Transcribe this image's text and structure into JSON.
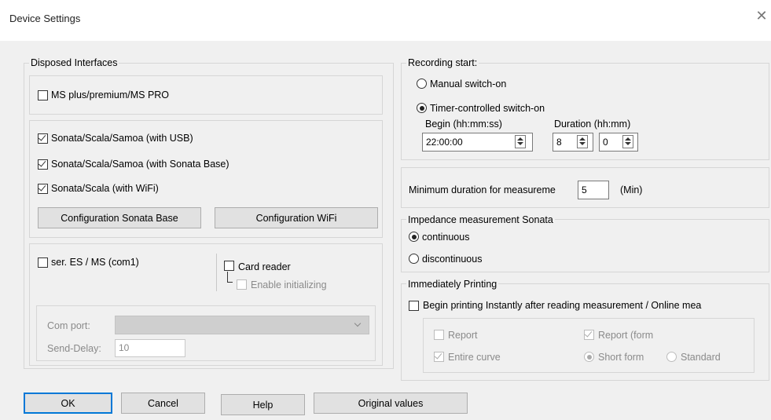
{
  "window": {
    "title": "Device Settings",
    "close_glyph": "✕"
  },
  "disposed": {
    "label": "Disposed Interfaces",
    "ms_plus": {
      "label": "MS plus/premium/MS PRO",
      "checked": false
    },
    "sonata_usb": {
      "label": "Sonata/Scala/Samoa (with USB)",
      "checked": true
    },
    "sonata_base": {
      "label": "Sonata/Scala/Samoa (with Sonata Base)",
      "checked": true
    },
    "sonata_wifi": {
      "label": "Sonata/Scala (with WiFi)",
      "checked": true
    },
    "config_base_btn": "Configuration Sonata Base",
    "config_wifi_btn": "Configuration WiFi",
    "ser": {
      "label": "ser. ES / MS (com1)",
      "checked": false
    },
    "card_reader": {
      "label": "Card reader",
      "checked": false
    },
    "enable_init": {
      "label": "Enable initializing",
      "checked": false
    },
    "com_port": {
      "label": "Com port:",
      "value": ""
    },
    "send_delay": {
      "label": "Send-Delay:",
      "value": "10"
    }
  },
  "recording": {
    "label": "Recording start:",
    "manual": {
      "label": "Manual switch-on",
      "selected": false
    },
    "timer": {
      "label": "Timer-controlled switch-on",
      "selected": true
    },
    "begin_label": "Begin (hh:mm:ss)",
    "begin_value": "22:00:00",
    "duration_label": "Duration (hh:mm)",
    "duration_h": "8",
    "duration_m": "0"
  },
  "min_duration": {
    "label": "Minimum duration for measureme",
    "value": "5",
    "unit": "(Min)"
  },
  "impedance": {
    "label": "Impedance measurement Sonata",
    "continuous": {
      "label": "continuous",
      "selected": true
    },
    "discontinuous": {
      "label": "discontinuous",
      "selected": false
    }
  },
  "printing": {
    "label": "Immediately Printing",
    "begin_printing": {
      "label": "Begin printing Instantly after reading measurement / Online mea",
      "checked": false
    },
    "report": {
      "label": "Report",
      "checked": false
    },
    "report_form": {
      "label": "Report (form",
      "checked": true
    },
    "entire_curve": {
      "label": "Entire curve",
      "checked": true
    },
    "short_form": {
      "label": "Short form",
      "selected": true
    },
    "standard": {
      "label": "Standard",
      "selected": false
    }
  },
  "buttons": {
    "ok": "OK",
    "cancel": "Cancel",
    "help": "Help",
    "original": "Original values"
  },
  "colors": {
    "accent": "#0078d7",
    "background": "#f0f0f0"
  }
}
